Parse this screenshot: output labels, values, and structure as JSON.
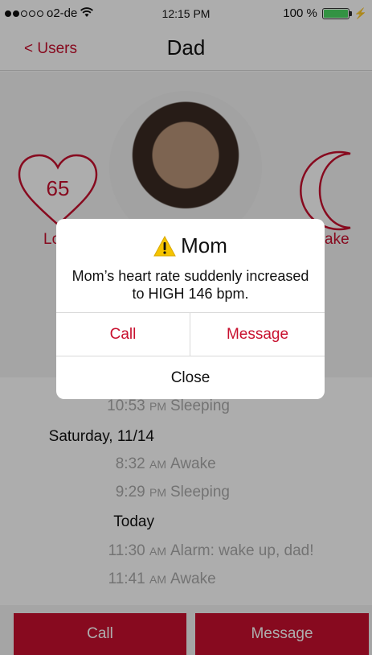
{
  "status_bar": {
    "carrier": "o2-de",
    "time": "12:15 PM",
    "battery": "100 %"
  },
  "nav": {
    "back_label": "< Users",
    "title": "Dad"
  },
  "profile": {
    "heart_rate": "65",
    "heart_label": "Lo",
    "sleep_label": "ake"
  },
  "timeline": {
    "rows": [
      {
        "time": "10:53",
        "ampm": "PM",
        "text": "Sleeping"
      },
      {
        "day": "Saturday, 11/14"
      },
      {
        "time": "8:32",
        "ampm": "AM",
        "text": "Awake"
      },
      {
        "time": "9:29",
        "ampm": "PM",
        "text": "Sleeping"
      },
      {
        "day": "Today"
      },
      {
        "time": "11:30",
        "ampm": "AM",
        "text": "Alarm: wake up, dad!"
      },
      {
        "time": "11:41",
        "ampm": "AM",
        "text": "Awake"
      }
    ]
  },
  "bottom": {
    "call_label": "Call",
    "message_label": "Message"
  },
  "alert": {
    "title": "Mom",
    "message": "Mom’s heart rate suddenly increased to HIGH 146 bpm.",
    "call_label": "Call",
    "message_label": "Message",
    "close_label": "Close",
    "icon": "warning-icon"
  },
  "colors": {
    "accent": "#c8102e",
    "warning": "#f5c400",
    "battery": "#4cd964"
  }
}
